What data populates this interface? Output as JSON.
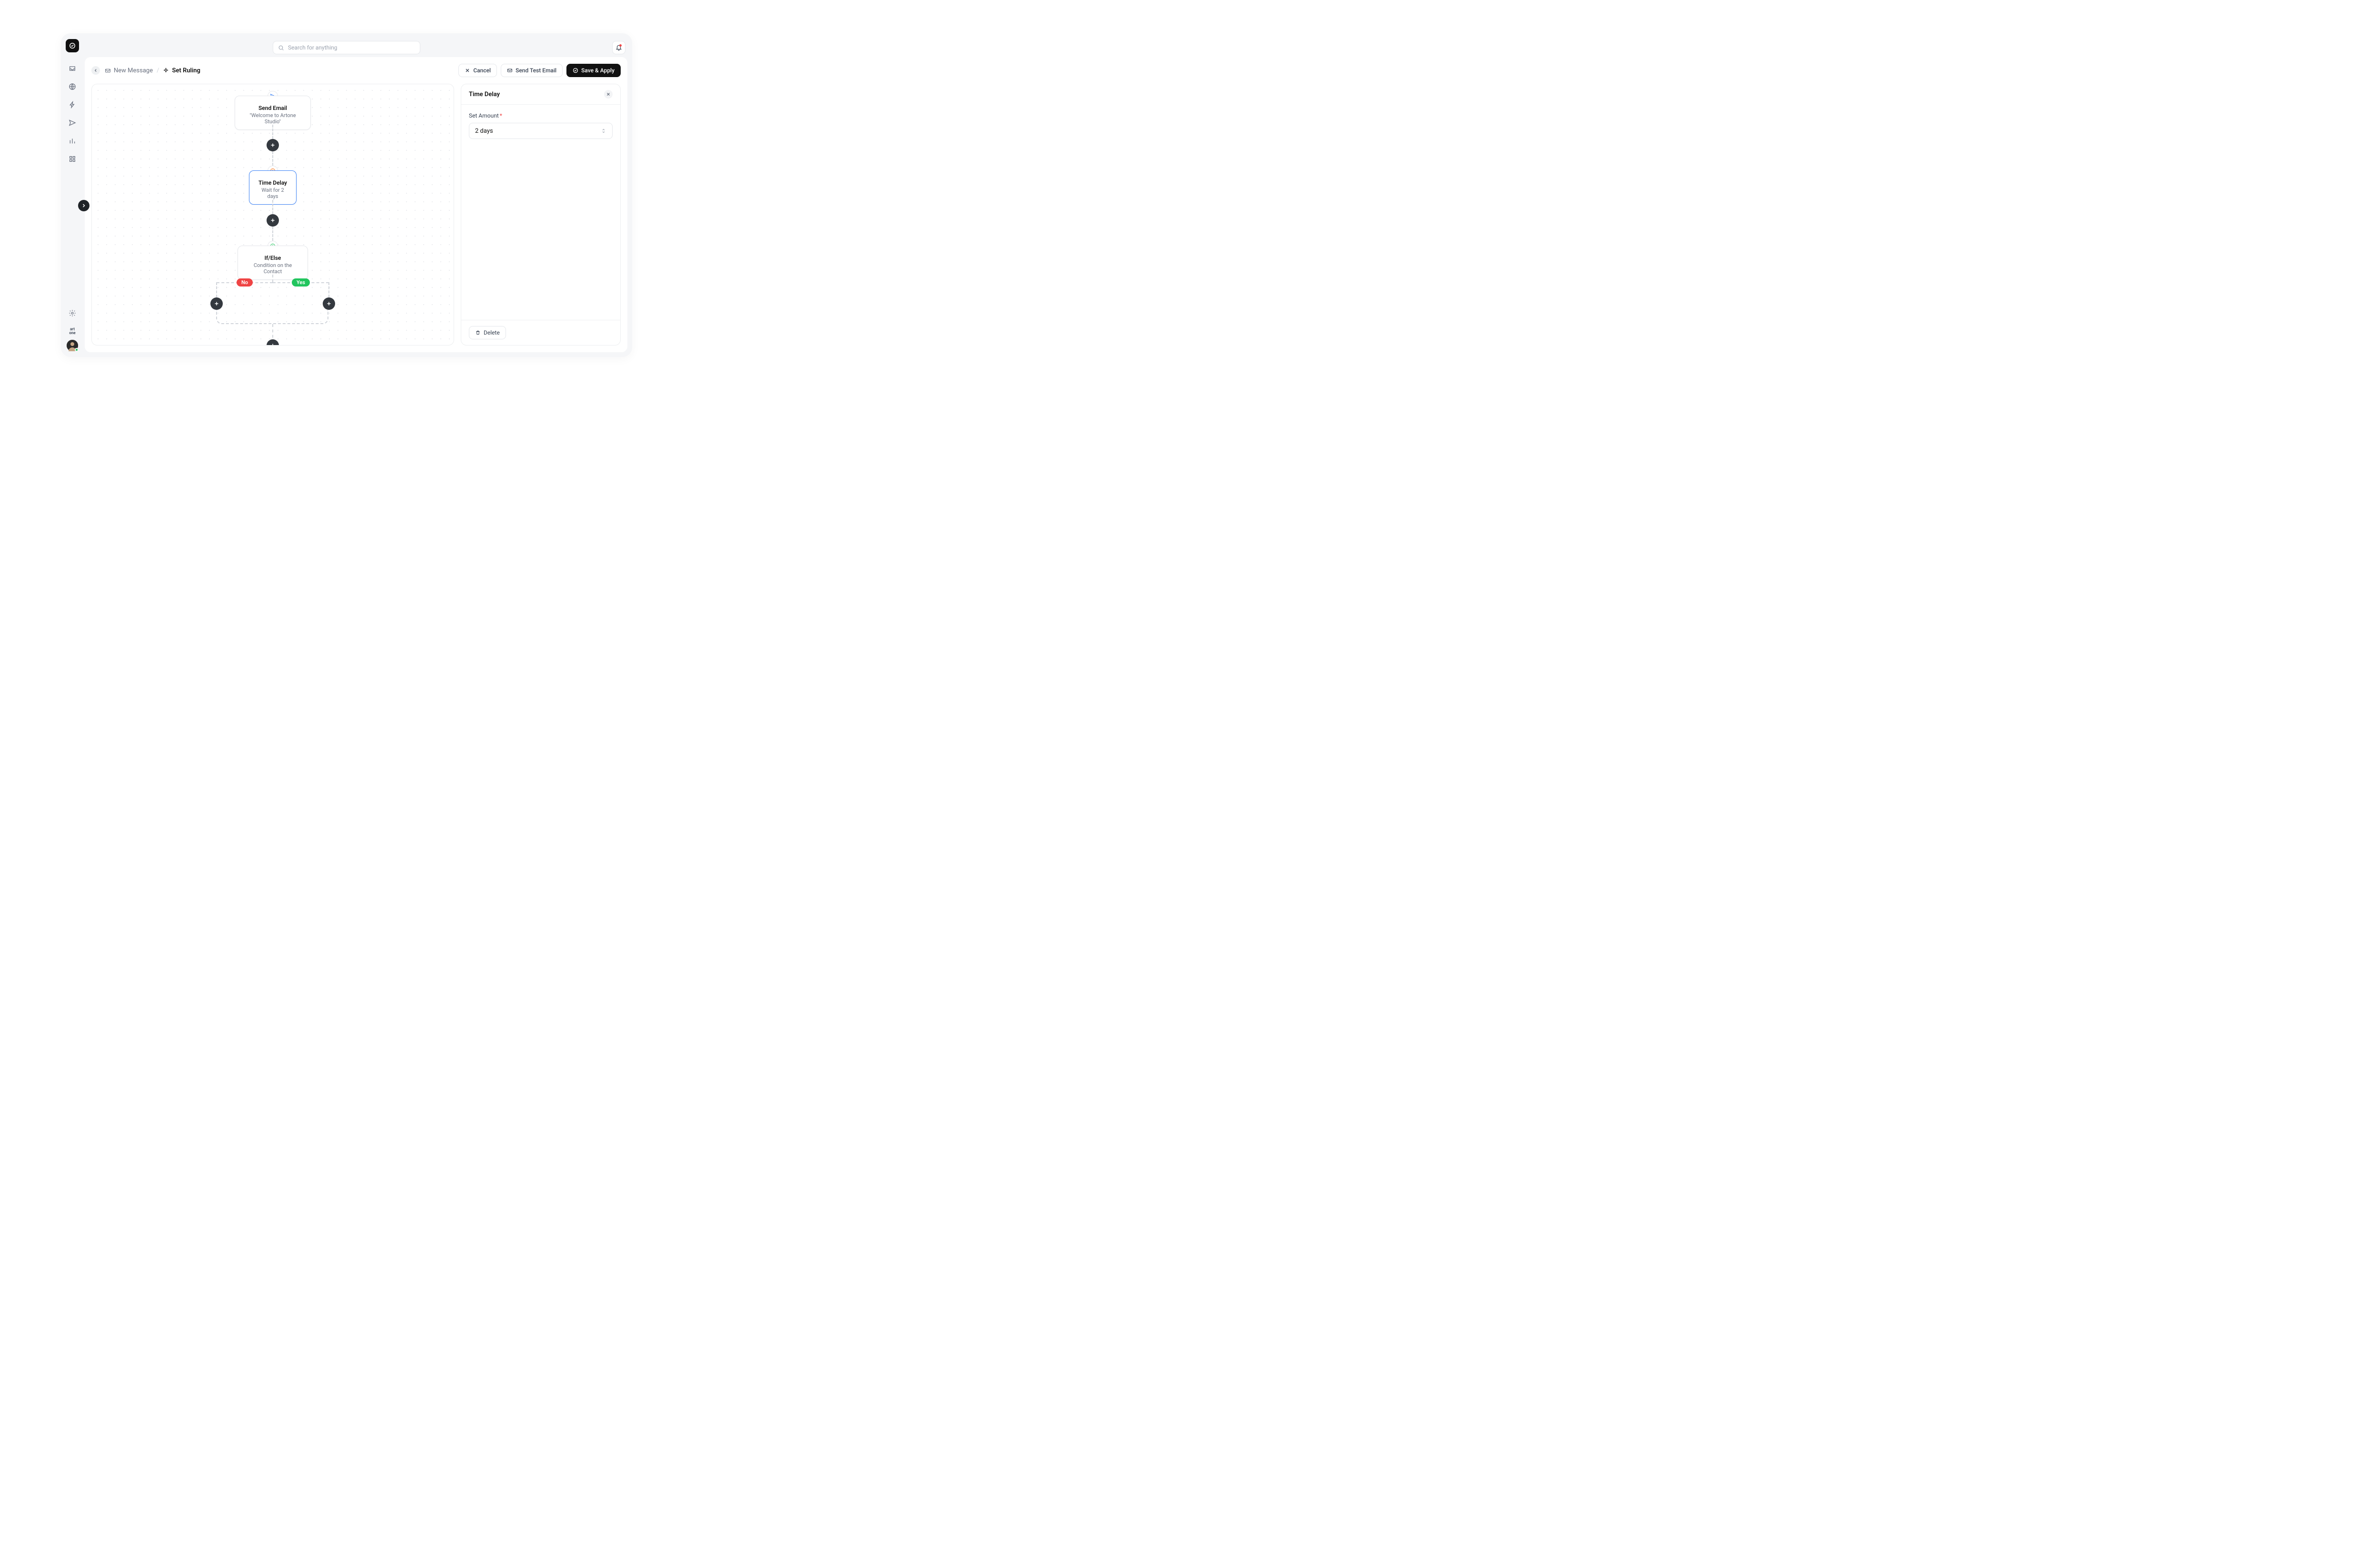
{
  "topbar": {
    "search_placeholder": "Search for anything"
  },
  "workspace": {
    "line1": "art",
    "line2": "one"
  },
  "header": {
    "breadcrumb_prev": "New Message",
    "breadcrumb_current": "Set Ruling",
    "cancel": "Cancel",
    "send_test": "Send Test Email",
    "save": "Save & Apply"
  },
  "flow": {
    "node1_title": "Send Email",
    "node1_sub": "\"Welcome to Artone Studio\"",
    "node2_title": "Time Delay",
    "node2_sub": "Wait for 2 days",
    "node3_title": "If/Else",
    "node3_sub": "Condition on the Contact",
    "branch_no": "No",
    "branch_yes": "Yes"
  },
  "panel": {
    "title": "Time Delay",
    "field_label": "Set Amount",
    "field_value": "2 days",
    "delete_label": "Delete"
  }
}
